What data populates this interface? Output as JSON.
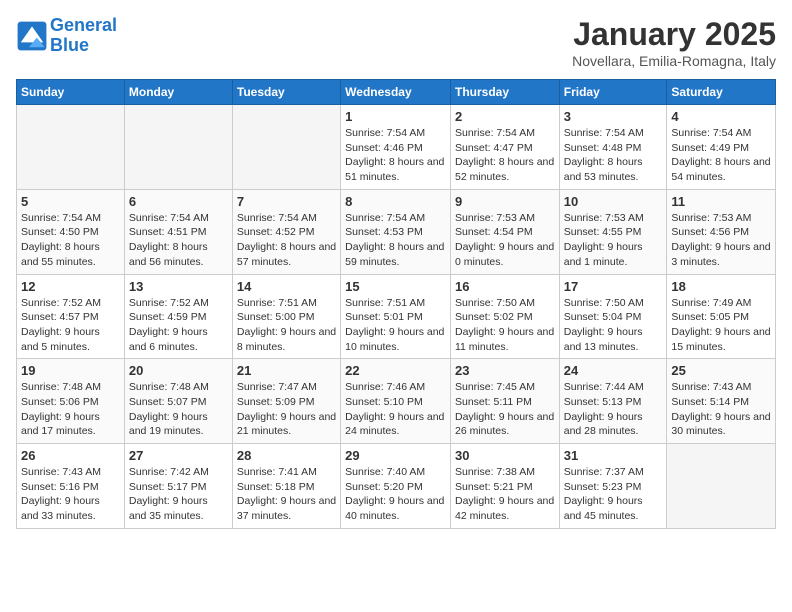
{
  "header": {
    "logo_line1": "General",
    "logo_line2": "Blue",
    "month": "January 2025",
    "location": "Novellara, Emilia-Romagna, Italy"
  },
  "weekdays": [
    "Sunday",
    "Monday",
    "Tuesday",
    "Wednesday",
    "Thursday",
    "Friday",
    "Saturday"
  ],
  "weeks": [
    [
      {
        "day": "",
        "empty": true
      },
      {
        "day": "",
        "empty": true
      },
      {
        "day": "",
        "empty": true
      },
      {
        "day": "1",
        "sunrise": "7:54 AM",
        "sunset": "4:46 PM",
        "daylight": "8 hours and 51 minutes."
      },
      {
        "day": "2",
        "sunrise": "7:54 AM",
        "sunset": "4:47 PM",
        "daylight": "8 hours and 52 minutes."
      },
      {
        "day": "3",
        "sunrise": "7:54 AM",
        "sunset": "4:48 PM",
        "daylight": "8 hours and 53 minutes."
      },
      {
        "day": "4",
        "sunrise": "7:54 AM",
        "sunset": "4:49 PM",
        "daylight": "8 hours and 54 minutes."
      }
    ],
    [
      {
        "day": "5",
        "sunrise": "7:54 AM",
        "sunset": "4:50 PM",
        "daylight": "8 hours and 55 minutes."
      },
      {
        "day": "6",
        "sunrise": "7:54 AM",
        "sunset": "4:51 PM",
        "daylight": "8 hours and 56 minutes."
      },
      {
        "day": "7",
        "sunrise": "7:54 AM",
        "sunset": "4:52 PM",
        "daylight": "8 hours and 57 minutes."
      },
      {
        "day": "8",
        "sunrise": "7:54 AM",
        "sunset": "4:53 PM",
        "daylight": "8 hours and 59 minutes."
      },
      {
        "day": "9",
        "sunrise": "7:53 AM",
        "sunset": "4:54 PM",
        "daylight": "9 hours and 0 minutes."
      },
      {
        "day": "10",
        "sunrise": "7:53 AM",
        "sunset": "4:55 PM",
        "daylight": "9 hours and 1 minute."
      },
      {
        "day": "11",
        "sunrise": "7:53 AM",
        "sunset": "4:56 PM",
        "daylight": "9 hours and 3 minutes."
      }
    ],
    [
      {
        "day": "12",
        "sunrise": "7:52 AM",
        "sunset": "4:57 PM",
        "daylight": "9 hours and 5 minutes."
      },
      {
        "day": "13",
        "sunrise": "7:52 AM",
        "sunset": "4:59 PM",
        "daylight": "9 hours and 6 minutes."
      },
      {
        "day": "14",
        "sunrise": "7:51 AM",
        "sunset": "5:00 PM",
        "daylight": "9 hours and 8 minutes."
      },
      {
        "day": "15",
        "sunrise": "7:51 AM",
        "sunset": "5:01 PM",
        "daylight": "9 hours and 10 minutes."
      },
      {
        "day": "16",
        "sunrise": "7:50 AM",
        "sunset": "5:02 PM",
        "daylight": "9 hours and 11 minutes."
      },
      {
        "day": "17",
        "sunrise": "7:50 AM",
        "sunset": "5:04 PM",
        "daylight": "9 hours and 13 minutes."
      },
      {
        "day": "18",
        "sunrise": "7:49 AM",
        "sunset": "5:05 PM",
        "daylight": "9 hours and 15 minutes."
      }
    ],
    [
      {
        "day": "19",
        "sunrise": "7:48 AM",
        "sunset": "5:06 PM",
        "daylight": "9 hours and 17 minutes."
      },
      {
        "day": "20",
        "sunrise": "7:48 AM",
        "sunset": "5:07 PM",
        "daylight": "9 hours and 19 minutes."
      },
      {
        "day": "21",
        "sunrise": "7:47 AM",
        "sunset": "5:09 PM",
        "daylight": "9 hours and 21 minutes."
      },
      {
        "day": "22",
        "sunrise": "7:46 AM",
        "sunset": "5:10 PM",
        "daylight": "9 hours and 24 minutes."
      },
      {
        "day": "23",
        "sunrise": "7:45 AM",
        "sunset": "5:11 PM",
        "daylight": "9 hours and 26 minutes."
      },
      {
        "day": "24",
        "sunrise": "7:44 AM",
        "sunset": "5:13 PM",
        "daylight": "9 hours and 28 minutes."
      },
      {
        "day": "25",
        "sunrise": "7:43 AM",
        "sunset": "5:14 PM",
        "daylight": "9 hours and 30 minutes."
      }
    ],
    [
      {
        "day": "26",
        "sunrise": "7:43 AM",
        "sunset": "5:16 PM",
        "daylight": "9 hours and 33 minutes."
      },
      {
        "day": "27",
        "sunrise": "7:42 AM",
        "sunset": "5:17 PM",
        "daylight": "9 hours and 35 minutes."
      },
      {
        "day": "28",
        "sunrise": "7:41 AM",
        "sunset": "5:18 PM",
        "daylight": "9 hours and 37 minutes."
      },
      {
        "day": "29",
        "sunrise": "7:40 AM",
        "sunset": "5:20 PM",
        "daylight": "9 hours and 40 minutes."
      },
      {
        "day": "30",
        "sunrise": "7:38 AM",
        "sunset": "5:21 PM",
        "daylight": "9 hours and 42 minutes."
      },
      {
        "day": "31",
        "sunrise": "7:37 AM",
        "sunset": "5:23 PM",
        "daylight": "9 hours and 45 minutes."
      },
      {
        "day": "",
        "empty": true
      }
    ]
  ]
}
